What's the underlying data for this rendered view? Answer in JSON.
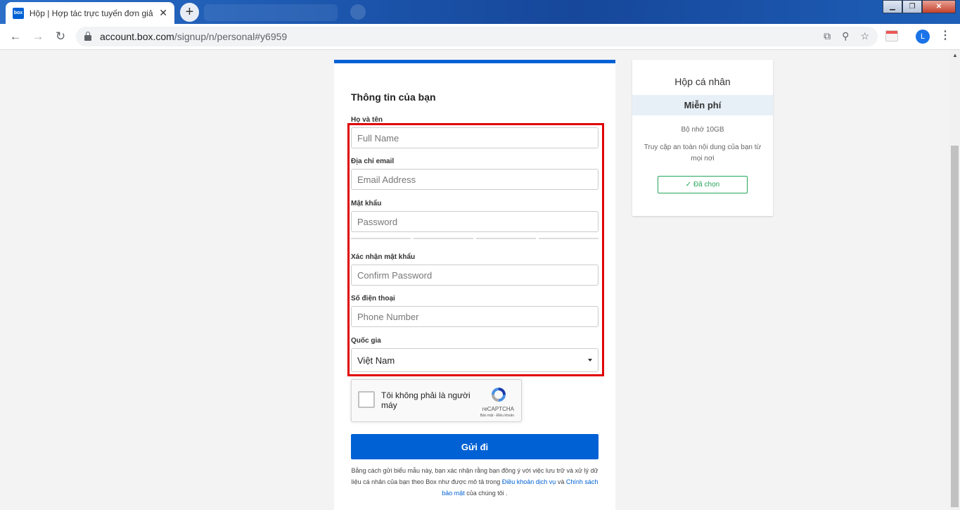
{
  "browser": {
    "tab_title": "Hộp | Hợp tác trực tuyến đơn giản",
    "favicon_text": "box",
    "close_glyph": "✕",
    "newtab_glyph": "+",
    "url_host": "account.box.com",
    "url_path": "/signup/n/personal#y6959",
    "avatar_letter": "L",
    "menu_glyph": "⋮"
  },
  "form": {
    "section_title": "Thông tin của bạn",
    "fields": [
      {
        "label": "Họ và tên",
        "placeholder": "Full Name"
      },
      {
        "label": "Địa chỉ email",
        "placeholder": "Email Address"
      },
      {
        "label": "Mật khẩu",
        "placeholder": "Password"
      },
      {
        "label": "Xác nhận mật khẩu",
        "placeholder": "Confirm Password"
      },
      {
        "label": "Số điện thoại",
        "placeholder": "Phone Number"
      }
    ],
    "country": {
      "label": "Quốc gia",
      "value": "Việt Nam"
    },
    "recaptcha": {
      "text": "Tôi không phải là người máy",
      "brand": "reCAPTCHA",
      "links": "Bảo mật - Điều khoản"
    },
    "submit_label": "Gửi đi",
    "legal": {
      "prefix": "Bằng cách gửi biểu mẫu này, bạn xác nhận rằng bạn đồng ý với việc lưu trữ và xử lý dữ liệu cá nhân của bạn theo Box như được mô tả trong",
      "terms_link": "Điều khoản dịch vụ",
      "and": "và",
      "privacy_link": "Chính sách bảo mật",
      "suffix": "của chúng tôi ."
    }
  },
  "plan": {
    "title": "Hộp cá nhân",
    "price": "Miễn phí",
    "storage": "Bộ nhớ 10GB",
    "description": "Truy cập an toàn nội dung của bạn từ mọi nơi",
    "selected_label": "✓ Đã chọn"
  },
  "colors": {
    "accent": "#0061d5",
    "highlight": "#e00000",
    "success": "#26a65b"
  },
  "icons": {
    "back": "arrow-left-icon",
    "forward": "arrow-right-icon",
    "reload": "reload-icon",
    "lock": "lock-icon",
    "translate": "translate-icon",
    "zoom": "zoom-icon",
    "bookmark": "star-icon"
  }
}
